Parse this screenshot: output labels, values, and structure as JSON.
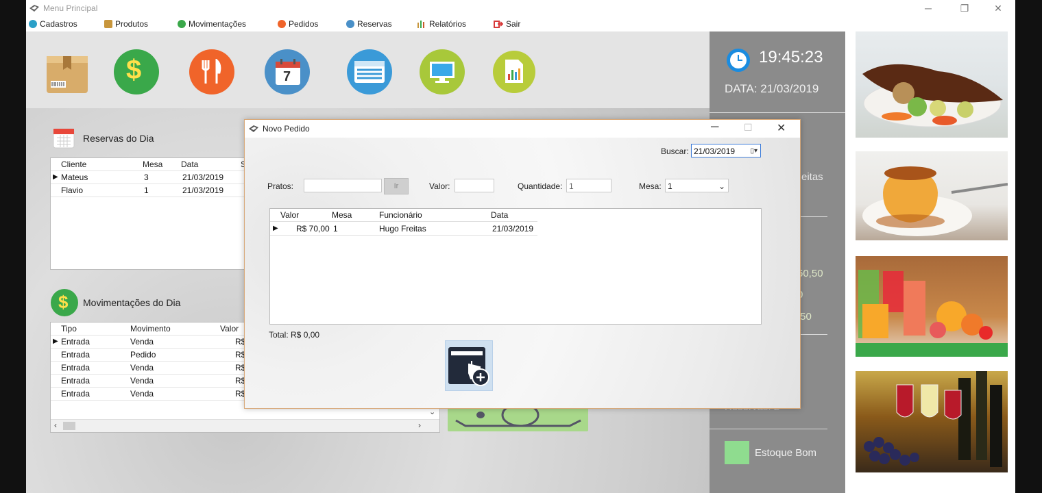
{
  "window": {
    "title": "Menu Principal"
  },
  "menu": [
    {
      "label": "Cadastros",
      "icon": "circle-icon",
      "color": "#2aa0c8"
    },
    {
      "label": "Produtos",
      "icon": "box-icon",
      "color": "#c8963c"
    },
    {
      "label": "Movimentações",
      "icon": "dollar-icon",
      "color": "#3aa84a"
    },
    {
      "label": "Pedidos",
      "icon": "cutlery-icon",
      "color": "#f0642a"
    },
    {
      "label": "Reservas",
      "icon": "calendar-icon",
      "color": "#4a90c8"
    },
    {
      "label": "Relatórios",
      "icon": "bar-chart-icon",
      "color": "#c85a2a"
    },
    {
      "label": "Sair",
      "icon": "exit-icon",
      "color": "#d83a3a"
    }
  ],
  "toolbar": [
    {
      "name": "produtos-button",
      "icon": "package-icon",
      "color": "#d8b070"
    },
    {
      "name": "movimentacoes-button",
      "icon": "dollar-icon",
      "color": "#3aa84a"
    },
    {
      "name": "pedidos-button",
      "icon": "cutlery-icon",
      "color": "#f0642a"
    },
    {
      "name": "reservas-button",
      "icon": "calendar-icon",
      "color": "#4a90c8",
      "day": "7"
    },
    {
      "name": "cadastros-button",
      "icon": "table-icon",
      "color": "#3a9ad8"
    },
    {
      "name": "monitor-button",
      "icon": "monitor-icon",
      "color": "#a8c83a"
    },
    {
      "name": "relatorios-button",
      "icon": "report-icon",
      "color": "#a8c83a"
    }
  ],
  "reservas": {
    "title": "Reservas do Dia",
    "columns": [
      "Cliente",
      "Mesa",
      "Data",
      "S"
    ],
    "rows": [
      {
        "cliente": "Mateus",
        "mesa": "3",
        "data": "21/03/2019"
      },
      {
        "cliente": "Flavio",
        "mesa": "1",
        "data": "21/03/2019"
      }
    ]
  },
  "movimentacoes": {
    "title": "Movimentações do Dia",
    "columns": [
      "Tipo",
      "Movimento",
      "Valor"
    ],
    "rows": [
      {
        "tipo": "Entrada",
        "movimento": "Venda",
        "valor": "R$"
      },
      {
        "tipo": "Entrada",
        "movimento": "Pedido",
        "valor": "R$"
      },
      {
        "tipo": "Entrada",
        "movimento": "Venda",
        "valor": "R$"
      },
      {
        "tipo": "Entrada",
        "movimento": "Venda",
        "valor": "R$"
      },
      {
        "tipo": "Entrada",
        "movimento": "Venda",
        "valor": "R$"
      }
    ]
  },
  "info": {
    "time": "19:45:23",
    "date": "DATA: 21/03/2019",
    "partial_name": "eitas",
    "partial_values": [
      "60,50",
      "0",
      ",50"
    ],
    "reservas_label": "Reservas: 2",
    "estoque_label": "Estoque Bom",
    "estoque_color": "#8fdc8f"
  },
  "dialog": {
    "title": "Novo Pedido",
    "buscar_label": "Buscar:",
    "buscar_value": "21/03/2019",
    "pratos_label": "Pratos:",
    "pratos_value": "",
    "ir_label": "Ir",
    "valor_label": "Valor:",
    "valor_value": "",
    "quantidade_label": "Quantidade:",
    "quantidade_value": "1",
    "mesa_label": "Mesa:",
    "mesa_value": "1",
    "columns": [
      "Valor",
      "Mesa",
      "Funcionário",
      "Data"
    ],
    "rows": [
      {
        "valor": "R$ 70,00",
        "mesa": "1",
        "funcionario": "Hugo Freitas",
        "data": "21/03/2019"
      }
    ],
    "total": "Total:  R$ 0,00"
  }
}
